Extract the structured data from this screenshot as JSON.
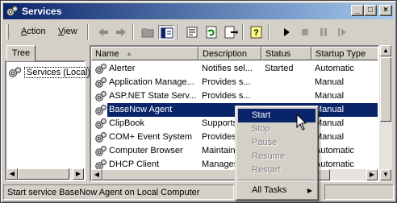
{
  "window": {
    "title": "Services",
    "controls": {
      "minimize": "_",
      "maximize": "□",
      "close": "×"
    }
  },
  "menubar": {
    "items": [
      {
        "label": "Action",
        "mnemonic": "A",
        "rest": "ction"
      },
      {
        "label": "View",
        "mnemonic": "V",
        "rest": "iew"
      }
    ],
    "tools": [
      "back-arrow-icon",
      "forward-arrow-icon",
      "up-folder-icon",
      "show-hide-tree-icon",
      "properties-icon",
      "refresh-icon",
      "export-list-icon",
      "help-icon",
      "play-icon",
      "stop-icon",
      "pause-icon",
      "restart-icon"
    ]
  },
  "tree": {
    "tab_label": "Tree",
    "root_label": "Services (Local)"
  },
  "list": {
    "columns": [
      "Name",
      "Description",
      "Status",
      "Startup Type"
    ],
    "sort_indicator": "▲",
    "rows": [
      {
        "name": "Alerter",
        "description": "Notifies sel...",
        "status": "Started",
        "startup": "Automatic"
      },
      {
        "name": "Application Manage...",
        "description": "Provides s...",
        "status": "",
        "startup": "Manual"
      },
      {
        "name": "ASP.NET State Serv...",
        "description": "Provides s...",
        "status": "",
        "startup": "Manual"
      },
      {
        "name": "BaseNow Agent",
        "description": "",
        "status": "",
        "startup": "Manual",
        "selected": true
      },
      {
        "name": "ClipBook",
        "description": "Supports",
        "status": "",
        "startup": "Manual"
      },
      {
        "name": "COM+ Event System",
        "description": "Provides",
        "status": "",
        "startup": "Manual"
      },
      {
        "name": "Computer Browser",
        "description": "Maintains",
        "status": "",
        "startup": "Automatic"
      },
      {
        "name": "DHCP Client",
        "description": "Manages",
        "status": "",
        "startup": "Automatic"
      }
    ]
  },
  "context_menu": {
    "items": [
      {
        "label": "Start",
        "enabled": true,
        "highlighted": true
      },
      {
        "label": "Stop",
        "enabled": false
      },
      {
        "label": "Pause",
        "enabled": false
      },
      {
        "label": "Resume",
        "enabled": false
      },
      {
        "label": "Restart",
        "enabled": false
      },
      {
        "label": "All Tasks",
        "enabled": true,
        "submenu": true
      }
    ],
    "submenu_arrow": "▶"
  },
  "statusbar": {
    "text": "Start service BaseNow Agent on Local Computer"
  },
  "scroll": {
    "left": "◀",
    "right": "▶",
    "up": "▲",
    "down": "▼"
  },
  "colors": {
    "titlebar_start": "#0a246a",
    "titlebar_end": "#a6caf0",
    "selection": "#0a246a",
    "face": "#d4d0c8"
  }
}
